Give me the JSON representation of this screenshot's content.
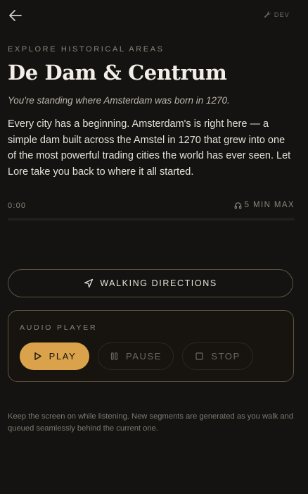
{
  "header": {
    "back_icon": "arrow-left-icon",
    "dev_icon": "wrench-icon",
    "dev_label": "DEV"
  },
  "section": {
    "eyebrow": "EXPLORE HISTORICAL AREAS",
    "title": "De Dam & Centrum",
    "tagline": "You're standing where Amsterdam was born in 1270.",
    "description": "Every city has a beginning. Amsterdam's is right here — a simple dam built across the Amstel in 1270 that grew into one of the most powerful trading cities the world has ever seen. Let Lore take you back to where it all started."
  },
  "playback": {
    "elapsed": "0:00",
    "max_icon": "headphones-icon",
    "max_label": "5 MIN MAX",
    "progress_fraction": 0
  },
  "directions": {
    "icon": "navigation-arrow-icon",
    "label": "WALKING DIRECTIONS"
  },
  "player": {
    "label": "AUDIO PLAYER",
    "play_label": "PLAY",
    "pause_label": "PAUSE",
    "stop_label": "STOP"
  },
  "footer": {
    "note": "Keep the screen on while listening. New segments are generated as you walk and queued seamlessly behind the current one."
  },
  "colors": {
    "background": "#151311",
    "accent": "#d9a24b",
    "border": "#5d5440",
    "muted_text": "#8a847b"
  }
}
